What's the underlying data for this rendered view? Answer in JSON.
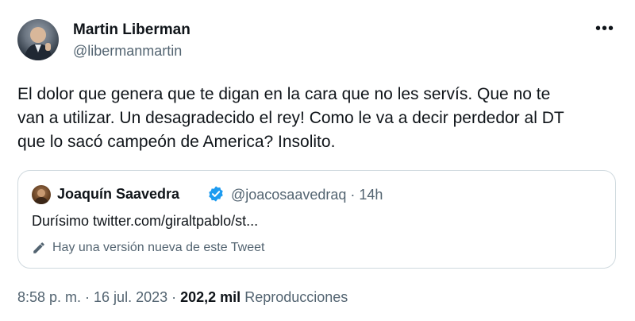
{
  "author": {
    "name": "Martin Liberman",
    "handle": "@libermanmartin"
  },
  "menu_icon": "more-horizontal-icon",
  "tweet_lines": [
    "El dolor que genera que te digan en la cara que no les servís. Que no te",
    "van a utilizar. Un desagradecido el rey! Como le va a decir perdedor al DT",
    "que lo sacó campeón de America? Insolito."
  ],
  "quoted": {
    "name": "Joaquín Saavedra",
    "verified_icon": "verified-badge-icon",
    "handle_time": "@joacosaavedraq · 14h",
    "text": "Durísimo twitter.com/giraltpablo/st...",
    "notice_icon": "edit-pencil-icon",
    "notice": "Hay una versión nueva de este Tweet"
  },
  "meta": {
    "timestamp": "8:58 p. m. · 16 jul. 2023 · ",
    "views_count": "202,2 mil",
    "views_label": "Reproducciones"
  },
  "colors": {
    "text": "#0f1419",
    "secondary": "#536471",
    "border": "#cfd9de",
    "verified": "#1d9bf0"
  }
}
